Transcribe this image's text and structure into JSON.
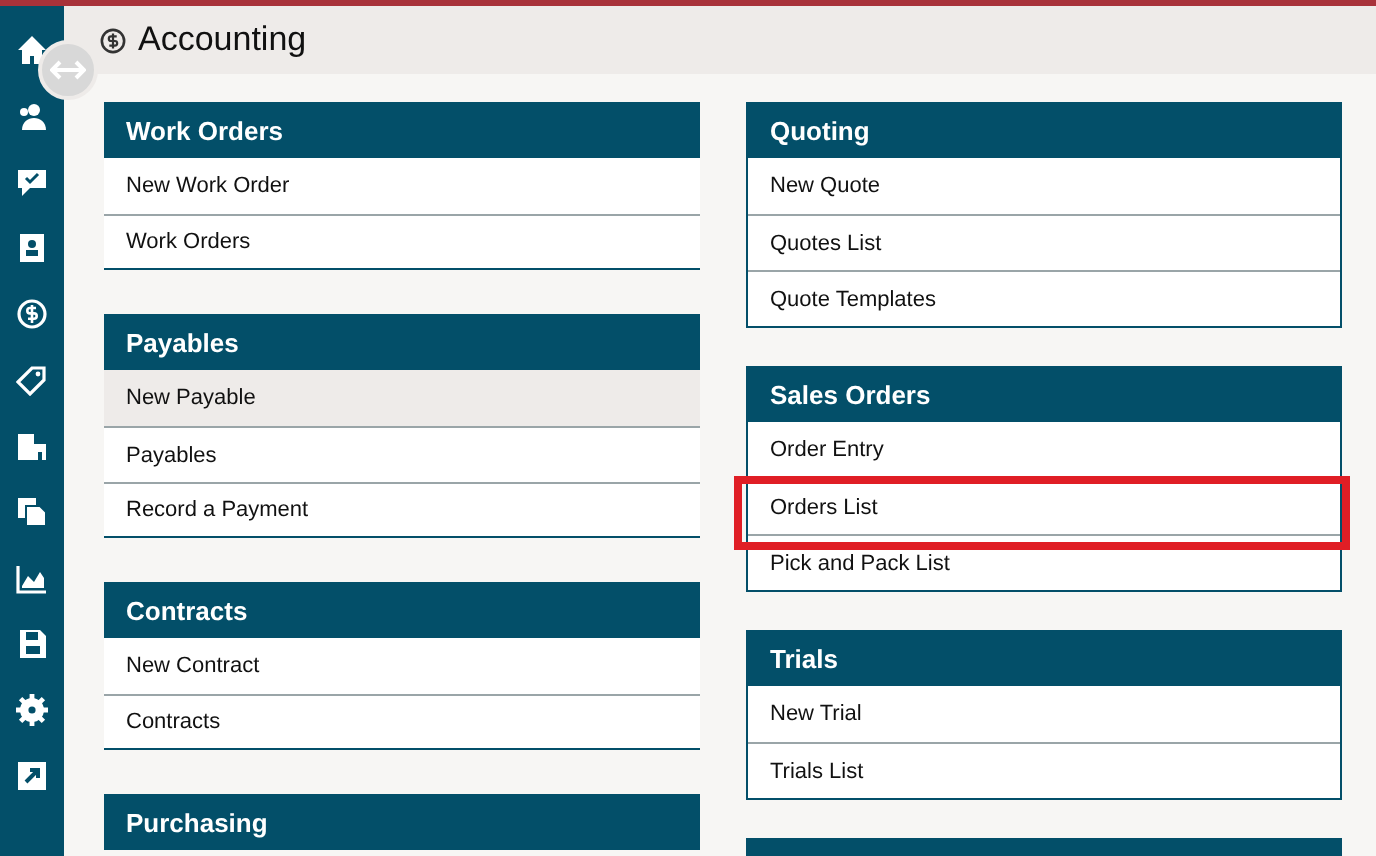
{
  "page": {
    "title": "Accounting"
  },
  "columns": [
    {
      "cards": [
        {
          "title": "Work Orders",
          "outlined": false,
          "items": [
            {
              "label": "New Work Order",
              "hovered": false,
              "highlighted": false
            },
            {
              "label": "Work Orders",
              "hovered": false,
              "highlighted": false
            }
          ]
        },
        {
          "title": "Payables",
          "outlined": false,
          "items": [
            {
              "label": "New Payable",
              "hovered": true,
              "highlighted": false
            },
            {
              "label": "Payables",
              "hovered": false,
              "highlighted": false
            },
            {
              "label": "Record a Payment",
              "hovered": false,
              "highlighted": false
            }
          ]
        },
        {
          "title": "Contracts",
          "outlined": false,
          "items": [
            {
              "label": "New Contract",
              "hovered": false,
              "highlighted": false
            },
            {
              "label": "Contracts",
              "hovered": false,
              "highlighted": false
            }
          ]
        },
        {
          "title": "Purchasing",
          "outlined": false
        }
      ]
    },
    {
      "cards": [
        {
          "title": "Quoting",
          "outlined": true,
          "items": [
            {
              "label": "New Quote",
              "hovered": false,
              "highlighted": false
            },
            {
              "label": "Quotes List",
              "hovered": false,
              "highlighted": false
            },
            {
              "label": "Quote Templates",
              "hovered": false,
              "highlighted": false
            }
          ]
        },
        {
          "title": "Sales Orders",
          "outlined": true,
          "items": [
            {
              "label": "Order Entry",
              "hovered": false,
              "highlighted": false
            },
            {
              "label": "Orders List",
              "hovered": false,
              "highlighted": true
            },
            {
              "label": "Pick and Pack List",
              "hovered": false,
              "highlighted": false
            }
          ]
        },
        {
          "title": "Trials",
          "outlined": true,
          "items": [
            {
              "label": "New Trial",
              "hovered": false,
              "highlighted": false
            },
            {
              "label": "Trials List",
              "hovered": false,
              "highlighted": false
            }
          ]
        },
        {
          "outlined": true
        }
      ]
    }
  ]
}
